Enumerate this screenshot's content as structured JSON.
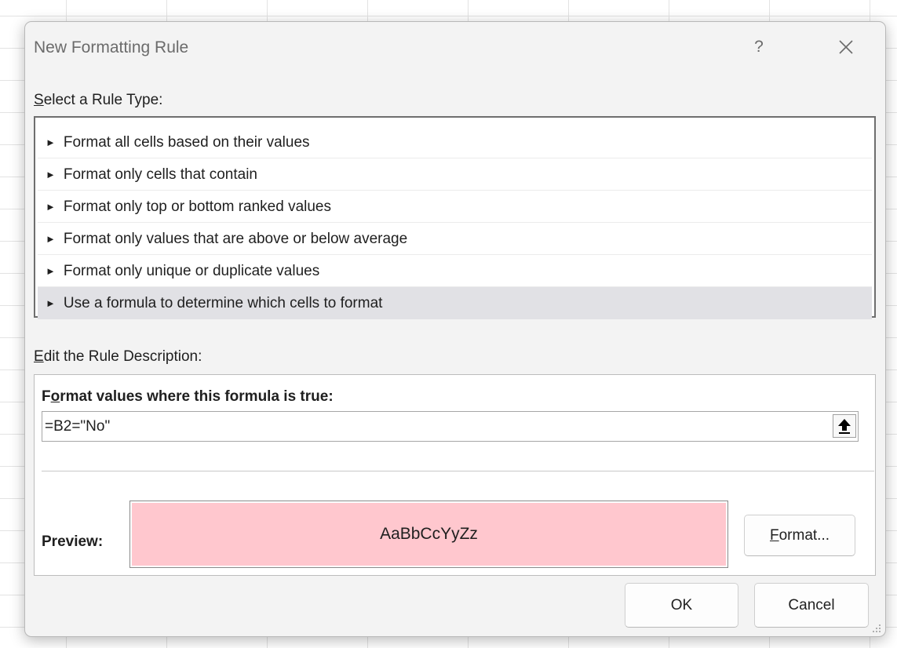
{
  "dialog": {
    "title": "New Formatting Rule",
    "help_label": "?",
    "close_icon": "close-icon"
  },
  "rule_type": {
    "label_accesskey": "S",
    "label_rest": "elect a Rule Type:",
    "items": [
      {
        "label": "Format all cells based on their values"
      },
      {
        "label": "Format only cells that contain"
      },
      {
        "label": "Format only top or bottom ranked values"
      },
      {
        "label": "Format only values that are above or below average"
      },
      {
        "label": "Format only unique or duplicate values"
      },
      {
        "label": "Use a formula to determine which cells to format"
      }
    ],
    "selected_index": 5
  },
  "description": {
    "label_accesskey": "E",
    "label_rest": "dit the Rule Description:",
    "formula_label_pre": "F",
    "formula_label_accesskey": "o",
    "formula_label_rest": "rmat values where this formula is true:",
    "formula_value": "=B2=\"No\"",
    "collapse_icon": "up-arrow-icon",
    "preview_label": "Preview:",
    "preview_text": "AaBbCcYyZz",
    "preview_fill": "#ffc7ce",
    "format_button_accesskey": "F",
    "format_button_rest": "ormat..."
  },
  "footer": {
    "ok_label": "OK",
    "cancel_label": "Cancel"
  },
  "watermark": ""
}
